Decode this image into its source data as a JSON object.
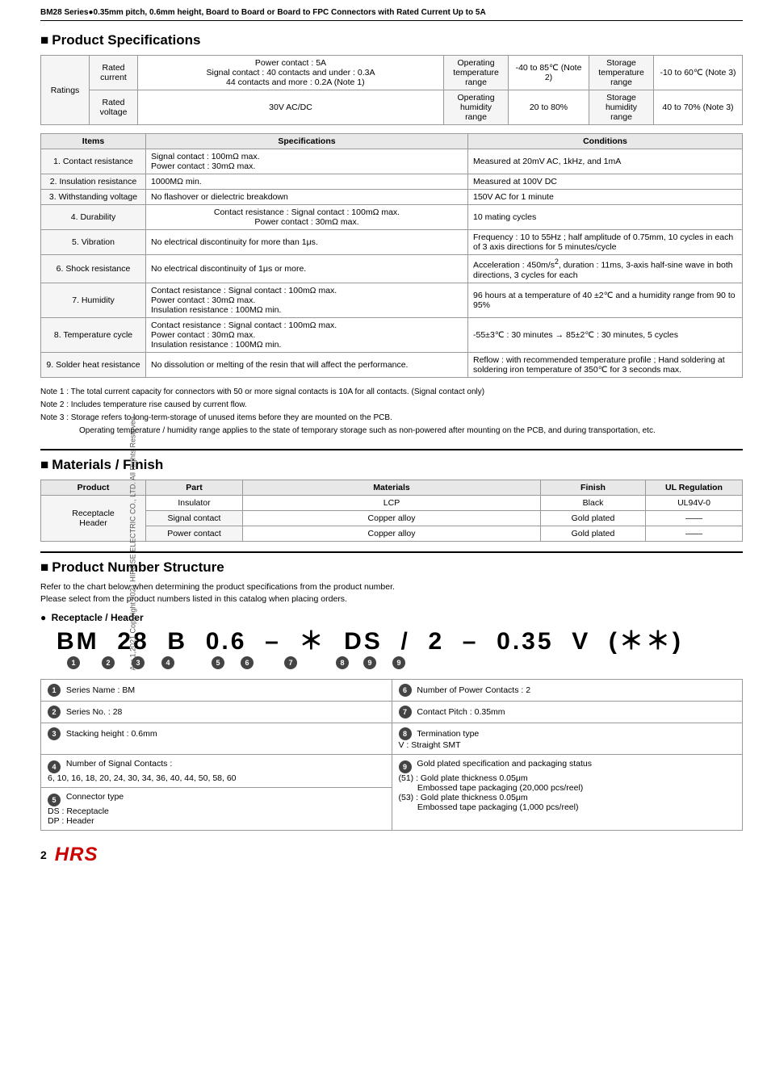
{
  "page": {
    "header": "BM28 Series●0.35mm pitch, 0.6mm height, Board to Board or Board to FPC Connectors with Rated Current Up to 5A",
    "side_text": "Apr.1,2021 Copyright 2021 HIROSE ELECTRIC CO., LTD. All Rights Reserved.",
    "page_number": "2"
  },
  "product_specs": {
    "heading": "Product Specifications",
    "ratings": {
      "rows": [
        {
          "label1": "Rated current",
          "value1": "Power contact : 5A\nSignal contact : 40 contacts and under : 0.3A\n44 contacts and more : 0.2A (Note 1)",
          "label2": "Operating temperature range",
          "value2": "-40 to 85℃ (Note 2)",
          "label3": "Storage temperature range",
          "value3": "-10 to 60℃ (Note 3)"
        },
        {
          "label1": "Rated voltage",
          "value1": "30V AC/DC",
          "label2": "Operating humidity range",
          "value2": "20 to 80%",
          "label3": "Storage humidity range",
          "value3": "40 to 70% (Note 3)"
        }
      ]
    },
    "spec_table": {
      "col_headers": [
        "Items",
        "Specifications",
        "Conditions"
      ],
      "rows": [
        {
          "item": "1. Contact resistance",
          "spec": "Signal contact : 100mΩ max.\nPower contact : 30mΩ max.",
          "cond": "Measured at 20mV AC, 1kHz, and 1mA"
        },
        {
          "item": "2. Insulation resistance",
          "spec": "1000MΩ min.",
          "cond": "Measured at 100V DC"
        },
        {
          "item": "3. Withstanding voltage",
          "spec": "No flashover or dielectric breakdown",
          "cond": "150V AC for 1 minute"
        },
        {
          "item": "4. Durability",
          "spec": "Contact resistance : Signal contact : 100mΩ max.\nPower contact : 30mΩ max.",
          "cond": "10 mating cycles"
        },
        {
          "item": "5. Vibration",
          "spec": "No electrical discontinuity for more than 1μs.",
          "cond": "Frequency : 10 to 55Hz ; half amplitude of 0.75mm, 10 cycles in each of 3 axis directions for 5 minutes/cycle"
        },
        {
          "item": "6. Shock resistance",
          "spec": "No electrical discontinuity of 1μs or more.",
          "cond": "Acceleration : 450m/s², duration : 11ms, 3-axis half-sine wave in both directions, 3 cycles for each"
        },
        {
          "item": "7. Humidity",
          "spec": "Contact resistance : Signal contact : 100mΩ max.\nPower contact : 30mΩ max.\nInsulation resistance : 100MΩ min.",
          "cond": "96 hours at a temperature of 40 ±2℃ and a humidity range from 90 to 95%"
        },
        {
          "item": "8. Temperature cycle",
          "spec": "Contact resistance : Signal contact : 100mΩ max.\nPower contact : 30mΩ max.\nInsulation resistance : 100MΩ min.",
          "cond": "-55±3℃ : 30 minutes → 85±2℃ : 30 minutes, 5 cycles"
        },
        {
          "item": "9. Solder heat resistance",
          "spec": "No dissolution or melting of the resin that will affect the performance.",
          "cond": "Reflow : with recommended temperature profile ; Hand soldering at soldering iron temperature of 350℃ for 3 seconds max."
        }
      ]
    },
    "notes": [
      "Note 1 : The total current capacity for connectors with 50 or more signal contacts is 10A for all contacts. (Signal contact only)",
      "Note 2 : Includes temperature rise caused by current flow.",
      "Note 3 : Storage refers to long-term-storage of unused items before they are mounted on the PCB.",
      "        Operating temperature / humidity range applies to the state of temporary storage such as non-powered after mounting on the PCB, and during transportation, etc."
    ]
  },
  "materials_finish": {
    "heading": "Materials / Finish",
    "col_headers": [
      "Product",
      "Part",
      "Materials",
      "Finish",
      "UL Regulation"
    ],
    "rows": [
      {
        "product": "Receptacle Header",
        "part": "Insulator",
        "materials": "LCP",
        "finish": "Black",
        "ul": "UL94V-0"
      },
      {
        "product": "",
        "part": "Signal contact",
        "materials": "Copper alloy",
        "finish": "Gold plated",
        "ul": "——"
      },
      {
        "product": "",
        "part": "Power contact",
        "materials": "Copper alloy",
        "finish": "Gold plated",
        "ul": "——"
      }
    ]
  },
  "product_number": {
    "heading": "Product Number Structure",
    "intro1": "Refer to the chart below when determining the product specifications from the product number.",
    "intro2": "Please select from the product numbers listed in this catalog when placing orders.",
    "sub_heading": "Receptacle / Header",
    "formula": "BM  28  B  0.6  –  ＊  DS  /  2  –  0.35  V  (＊＊)",
    "formula_parts": [
      "BM",
      "28",
      "B",
      "0.6",
      "–",
      "＊",
      "DS",
      "/",
      "2",
      "–",
      "0.35",
      "V",
      "(＊＊)"
    ],
    "circle_nums": [
      "①",
      "②",
      "③",
      "④",
      "",
      "⑤",
      "⑥",
      "",
      "⑦",
      "",
      "⑧",
      "⑨",
      "⑨"
    ],
    "legend_left": [
      {
        "num": "①",
        "label": "Series Name : BM"
      },
      {
        "num": "②",
        "label": "Series No. : 28"
      },
      {
        "num": "③",
        "label": "Stacking height : 0.6mm"
      },
      {
        "num": "④",
        "label": "Number of Signal Contacts :\n6, 10, 16, 18, 20, 24, 30, 34, 36, 40, 44, 50, 58, 60"
      },
      {
        "num": "⑤",
        "label": "Connector type\nDS : Receptacle\nDP : Header"
      }
    ],
    "legend_right": [
      {
        "num": "⑥",
        "label": "Number of Power Contacts : 2"
      },
      {
        "num": "⑦",
        "label": "Contact Pitch : 0.35mm"
      },
      {
        "num": "⑧",
        "label": "Termination type\nV : Straight SMT"
      },
      {
        "num": "⑨",
        "label": "Gold plated specification and packaging status\n(51) : Gold plate thickness 0.05μm\n        Embossed tape packaging (20,000 pcs/reel)\n(53) : Gold plate thickness 0.05μm\n        Embossed tape packaging (1,000 pcs/reel)"
      }
    ]
  }
}
